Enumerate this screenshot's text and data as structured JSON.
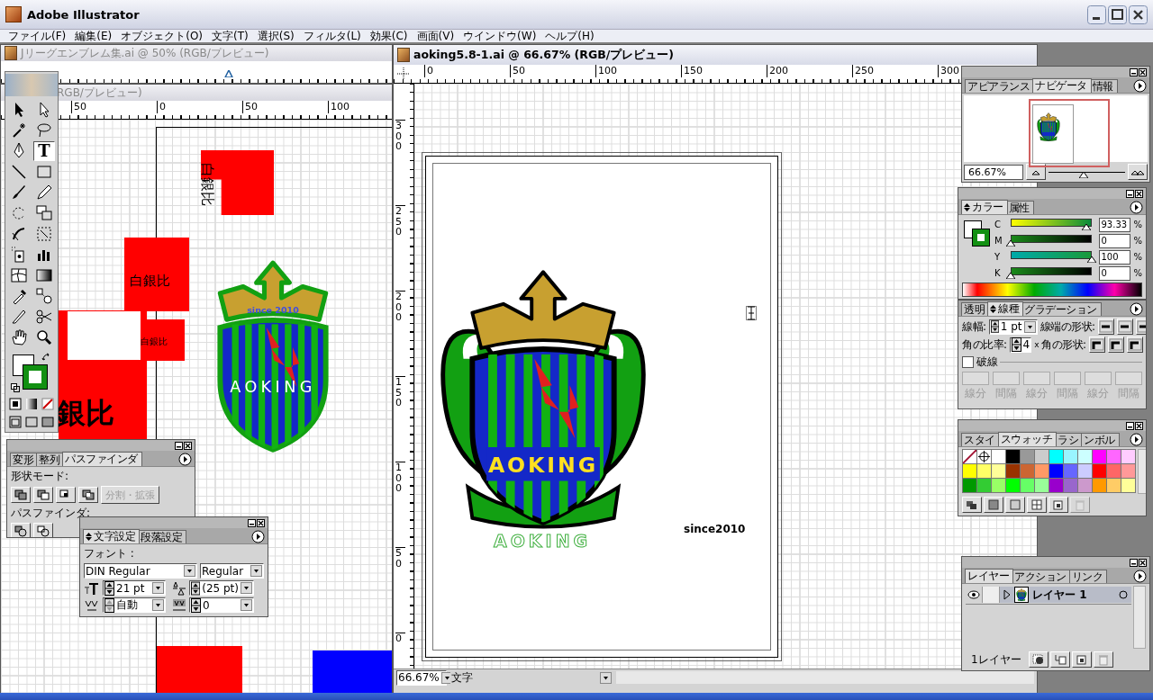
{
  "window": {
    "title": "Adobe Illustrator"
  },
  "menu": [
    "ファイル(F)",
    "編集(E)",
    "オブジェクト(O)",
    "文字(T)",
    "選択(S)",
    "フィルタ(L)",
    "効果(C)",
    "画面(V)",
    "ウインドウ(W)",
    "ヘルプ(H)"
  ],
  "background_documents": [
    {
      "title": "Jリーグエンブレム集.ai @ 50% (RGB/プレビュー)"
    },
    {
      "title": "RGB/プレビュー)",
      "ruler": [
        "50",
        "0",
        "50",
        "100"
      ]
    }
  ],
  "left_canvas": {
    "labels": [
      {
        "text": "白銀比",
        "kind": "rotated"
      },
      {
        "text": "白銀比",
        "kind": "medium"
      },
      {
        "text": "白銀比",
        "kind": "small"
      },
      {
        "text": "銀比",
        "kind": "large"
      }
    ],
    "emblem": {
      "motto": "since 2010",
      "name": "AOKING"
    }
  },
  "toolbox": {
    "tools": [
      {
        "kind": "select",
        "selected": false
      },
      {
        "kind": "direct",
        "selected": false
      },
      {
        "kind": "wand",
        "selected": false
      },
      {
        "kind": "lasso",
        "selected": false
      },
      {
        "kind": "pen",
        "selected": false
      },
      {
        "kind": "type",
        "glyph": "T",
        "selected": true
      },
      {
        "kind": "line",
        "selected": false
      },
      {
        "kind": "rect",
        "selected": false
      },
      {
        "kind": "brush",
        "selected": false
      },
      {
        "kind": "pencil",
        "selected": false
      },
      {
        "kind": "rotate",
        "selected": false
      },
      {
        "kind": "scale",
        "selected": false
      },
      {
        "kind": "warp",
        "selected": false
      },
      {
        "kind": "transform",
        "selected": false
      },
      {
        "kind": "spray",
        "selected": false
      },
      {
        "kind": "graph",
        "selected": false
      },
      {
        "kind": "mesh",
        "selected": false
      },
      {
        "kind": "gradient",
        "selected": false
      },
      {
        "kind": "eyedropper",
        "selected": false
      },
      {
        "kind": "blend",
        "selected": false
      },
      {
        "kind": "knife",
        "selected": false
      },
      {
        "kind": "scissors",
        "selected": false
      },
      {
        "kind": "hand",
        "selected": false
      },
      {
        "kind": "zoom",
        "selected": false
      }
    ]
  },
  "pathfinder_panel": {
    "tabs": [
      {
        "label": "変形",
        "selected": false
      },
      {
        "label": "整列",
        "selected": false
      },
      {
        "label": "パスファインダ",
        "selected": true
      }
    ],
    "shape_modes_label": "形状モード:",
    "expand_button": {
      "label": "分割・拡張",
      "disabled": true
    },
    "pathfinders_label": "パスファインダ:"
  },
  "character_panel": {
    "tabs": [
      {
        "label": "文字設定",
        "selected": true
      },
      {
        "label": "段落設定",
        "selected": false
      }
    ],
    "font_label": "フォント :",
    "font": "DIN Regular",
    "style": "Regular",
    "size": "21 pt",
    "leading": "(25 pt)",
    "kerning": "自動",
    "tracking": "0"
  },
  "active_document": {
    "title": "aoking5.8-1.ai @ 66.67% (RGB/プレビュー)",
    "h_ruler": [
      "0",
      "50",
      "100",
      "150",
      "200",
      "250",
      "300"
    ],
    "v_ruler": [
      "300",
      "250",
      "200",
      "150",
      "100",
      "50",
      "0"
    ],
    "emblem_name": "AOKING",
    "wordmark": "AOKING",
    "since": "since2010",
    "zoom": "66.67%",
    "status": "文字"
  },
  "navigator_panel": {
    "tabs": [
      {
        "label": "アピアランス",
        "selected": false
      },
      {
        "label": "ナビゲータ",
        "selected": true
      },
      {
        "label": "情報",
        "selected": false
      }
    ],
    "zoom": "66.67%",
    "level": 0.45
  },
  "color_panel": {
    "tabs": [
      {
        "label": "カラー",
        "selected": true
      },
      {
        "label": "属性",
        "selected": false
      }
    ],
    "channels": [
      {
        "name": "C",
        "level": 0.93,
        "value": "93.33",
        "unit": "%"
      },
      {
        "name": "M",
        "level": 0,
        "value": "0",
        "unit": "%"
      },
      {
        "name": "Y",
        "level": 1,
        "value": "100",
        "unit": "%"
      },
      {
        "name": "K",
        "level": 0,
        "value": "0",
        "unit": "%"
      }
    ]
  },
  "stroke_panel": {
    "tabs": [
      {
        "label": "透明",
        "selected": false
      },
      {
        "label": "線種",
        "selected": true
      },
      {
        "label": "グラデーション",
        "selected": false
      }
    ],
    "weight_label": "線幅:",
    "weight": "1 pt",
    "cap_label": "線端の形状:",
    "miter_label": "角の比率:",
    "miter": "4",
    "miter_unit": "x",
    "join_label": "角の形状:",
    "dashed": {
      "label": "破線",
      "checked": false
    },
    "dash_labels": [
      "線分",
      "間隔",
      "線分",
      "間隔",
      "線分",
      "間隔"
    ]
  },
  "swatches_panel": {
    "tabs": [
      {
        "label": "スタイ",
        "selected": false
      },
      {
        "label": "スウォッチ",
        "selected": true
      },
      {
        "label": "ラシ",
        "selected": false
      },
      {
        "label": "ンボル",
        "selected": false
      }
    ],
    "swatches": [
      {
        "kind": "none"
      },
      {
        "kind": "registration"
      },
      {
        "kind": "color",
        "color": "#ffffff"
      },
      {
        "kind": "color",
        "color": "#000000"
      },
      {
        "kind": "color",
        "color": "#999999"
      },
      {
        "kind": "color",
        "color": "#cccccc"
      },
      {
        "kind": "color",
        "color": "#00ffff"
      },
      {
        "kind": "color",
        "color": "#99f5ff"
      },
      {
        "kind": "color",
        "color": "#ccffff"
      },
      {
        "kind": "color",
        "color": "#ff00ff"
      },
      {
        "kind": "color",
        "color": "#ff66ff"
      },
      {
        "kind": "color",
        "color": "#ffccff"
      },
      {
        "kind": "color",
        "color": "#ffff00"
      },
      {
        "kind": "color",
        "color": "#ffff66"
      },
      {
        "kind": "color",
        "color": "#ffff99"
      },
      {
        "kind": "color",
        "color": "#993300"
      },
      {
        "kind": "color",
        "color": "#cc6633"
      },
      {
        "kind": "color",
        "color": "#ff9966"
      },
      {
        "kind": "color",
        "color": "#0000ff"
      },
      {
        "kind": "color",
        "color": "#6666ff"
      },
      {
        "kind": "color",
        "color": "#ccccff"
      },
      {
        "kind": "color",
        "color": "#ff0000"
      },
      {
        "kind": "color",
        "color": "#ff6666"
      },
      {
        "kind": "color",
        "color": "#ff9999"
      },
      {
        "kind": "color",
        "color": "#009900"
      },
      {
        "kind": "color",
        "color": "#33cc33"
      },
      {
        "kind": "color",
        "color": "#99ff66"
      },
      {
        "kind": "color",
        "color": "#00ff00"
      },
      {
        "kind": "color",
        "color": "#66ff66"
      },
      {
        "kind": "color",
        "color": "#99ff99"
      },
      {
        "kind": "color",
        "color": "#9900cc"
      },
      {
        "kind": "color",
        "color": "#9966cc"
      },
      {
        "kind": "color",
        "color": "#cc99cc"
      },
      {
        "kind": "color",
        "color": "#ff9900"
      },
      {
        "kind": "color",
        "color": "#ffcc66"
      },
      {
        "kind": "color",
        "color": "#ffff99"
      }
    ]
  },
  "layers_panel": {
    "tabs": [
      {
        "label": "レイヤー",
        "selected": true
      },
      {
        "label": "アクション",
        "selected": false
      },
      {
        "label": "リンク",
        "selected": false
      }
    ],
    "layers": [
      {
        "name": "レイヤー 1",
        "visible": true,
        "selected": true
      }
    ],
    "count": "1レイヤー"
  }
}
